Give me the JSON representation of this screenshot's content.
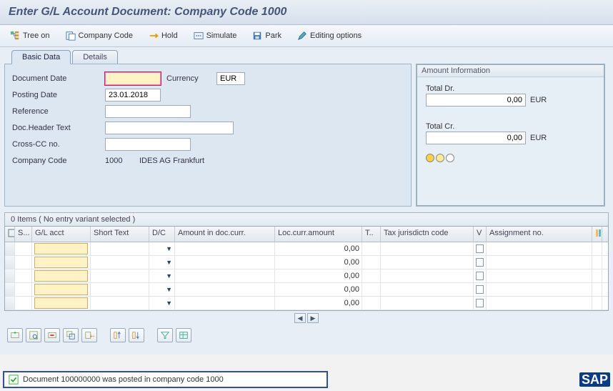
{
  "title": "Enter G/L Account Document: Company Code 1000",
  "toolbar": {
    "tree_on": "Tree on",
    "company_code": "Company Code",
    "hold": "Hold",
    "simulate": "Simulate",
    "park": "Park",
    "editing_options": "Editing options"
  },
  "tabs": {
    "basic_data": "Basic Data",
    "details": "Details"
  },
  "form": {
    "document_date_label": "Document Date",
    "document_date": "",
    "currency_label": "Currency",
    "currency": "EUR",
    "posting_date_label": "Posting Date",
    "posting_date": "23.01.2018",
    "reference_label": "Reference",
    "reference": "",
    "header_text_label": "Doc.Header Text",
    "header_text": "",
    "cross_cc_label": "Cross-CC no.",
    "cross_cc": "",
    "company_code_label": "Company Code",
    "company_code_value": "1000",
    "company_name": "IDES AG Frankfurt"
  },
  "amount_info": {
    "group_title": "Amount Information",
    "total_dr_label": "Total Dr.",
    "total_dr": "0,00",
    "total_cr_label": "Total Cr.",
    "total_cr": "0,00",
    "curr": "EUR"
  },
  "items_title": "0 Items ( No entry variant selected )",
  "grid": {
    "cols": {
      "s": "S...",
      "gl": "G/L acct",
      "st": "Short Text",
      "dc": "D/C",
      "amt": "Amount in doc.curr.",
      "loc": "Loc.curr.amount",
      "t": "T..",
      "tax": "Tax jurisdictn code",
      "v": "V",
      "asg": "Assignment no."
    },
    "rows": [
      {
        "loc": "0,00"
      },
      {
        "loc": "0,00"
      },
      {
        "loc": "0,00"
      },
      {
        "loc": "0,00"
      },
      {
        "loc": "0,00"
      }
    ]
  },
  "status_message": "Document 100000000 was posted in company code 1000"
}
